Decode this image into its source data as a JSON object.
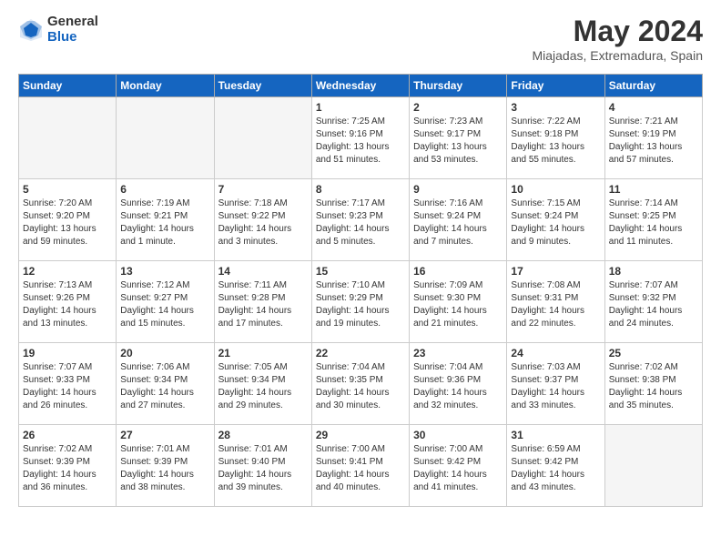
{
  "header": {
    "logo_general": "General",
    "logo_blue": "Blue",
    "title": "May 2024",
    "location": "Miajadas, Extremadura, Spain"
  },
  "columns": [
    "Sunday",
    "Monday",
    "Tuesday",
    "Wednesday",
    "Thursday",
    "Friday",
    "Saturday"
  ],
  "weeks": [
    [
      {
        "day": "",
        "info": ""
      },
      {
        "day": "",
        "info": ""
      },
      {
        "day": "",
        "info": ""
      },
      {
        "day": "1",
        "info": "Sunrise: 7:25 AM\nSunset: 9:16 PM\nDaylight: 13 hours\nand 51 minutes."
      },
      {
        "day": "2",
        "info": "Sunrise: 7:23 AM\nSunset: 9:17 PM\nDaylight: 13 hours\nand 53 minutes."
      },
      {
        "day": "3",
        "info": "Sunrise: 7:22 AM\nSunset: 9:18 PM\nDaylight: 13 hours\nand 55 minutes."
      },
      {
        "day": "4",
        "info": "Sunrise: 7:21 AM\nSunset: 9:19 PM\nDaylight: 13 hours\nand 57 minutes."
      }
    ],
    [
      {
        "day": "5",
        "info": "Sunrise: 7:20 AM\nSunset: 9:20 PM\nDaylight: 13 hours\nand 59 minutes."
      },
      {
        "day": "6",
        "info": "Sunrise: 7:19 AM\nSunset: 9:21 PM\nDaylight: 14 hours\nand 1 minute."
      },
      {
        "day": "7",
        "info": "Sunrise: 7:18 AM\nSunset: 9:22 PM\nDaylight: 14 hours\nand 3 minutes."
      },
      {
        "day": "8",
        "info": "Sunrise: 7:17 AM\nSunset: 9:23 PM\nDaylight: 14 hours\nand 5 minutes."
      },
      {
        "day": "9",
        "info": "Sunrise: 7:16 AM\nSunset: 9:24 PM\nDaylight: 14 hours\nand 7 minutes."
      },
      {
        "day": "10",
        "info": "Sunrise: 7:15 AM\nSunset: 9:24 PM\nDaylight: 14 hours\nand 9 minutes."
      },
      {
        "day": "11",
        "info": "Sunrise: 7:14 AM\nSunset: 9:25 PM\nDaylight: 14 hours\nand 11 minutes."
      }
    ],
    [
      {
        "day": "12",
        "info": "Sunrise: 7:13 AM\nSunset: 9:26 PM\nDaylight: 14 hours\nand 13 minutes."
      },
      {
        "day": "13",
        "info": "Sunrise: 7:12 AM\nSunset: 9:27 PM\nDaylight: 14 hours\nand 15 minutes."
      },
      {
        "day": "14",
        "info": "Sunrise: 7:11 AM\nSunset: 9:28 PM\nDaylight: 14 hours\nand 17 minutes."
      },
      {
        "day": "15",
        "info": "Sunrise: 7:10 AM\nSunset: 9:29 PM\nDaylight: 14 hours\nand 19 minutes."
      },
      {
        "day": "16",
        "info": "Sunrise: 7:09 AM\nSunset: 9:30 PM\nDaylight: 14 hours\nand 21 minutes."
      },
      {
        "day": "17",
        "info": "Sunrise: 7:08 AM\nSunset: 9:31 PM\nDaylight: 14 hours\nand 22 minutes."
      },
      {
        "day": "18",
        "info": "Sunrise: 7:07 AM\nSunset: 9:32 PM\nDaylight: 14 hours\nand 24 minutes."
      }
    ],
    [
      {
        "day": "19",
        "info": "Sunrise: 7:07 AM\nSunset: 9:33 PM\nDaylight: 14 hours\nand 26 minutes."
      },
      {
        "day": "20",
        "info": "Sunrise: 7:06 AM\nSunset: 9:34 PM\nDaylight: 14 hours\nand 27 minutes."
      },
      {
        "day": "21",
        "info": "Sunrise: 7:05 AM\nSunset: 9:34 PM\nDaylight: 14 hours\nand 29 minutes."
      },
      {
        "day": "22",
        "info": "Sunrise: 7:04 AM\nSunset: 9:35 PM\nDaylight: 14 hours\nand 30 minutes."
      },
      {
        "day": "23",
        "info": "Sunrise: 7:04 AM\nSunset: 9:36 PM\nDaylight: 14 hours\nand 32 minutes."
      },
      {
        "day": "24",
        "info": "Sunrise: 7:03 AM\nSunset: 9:37 PM\nDaylight: 14 hours\nand 33 minutes."
      },
      {
        "day": "25",
        "info": "Sunrise: 7:02 AM\nSunset: 9:38 PM\nDaylight: 14 hours\nand 35 minutes."
      }
    ],
    [
      {
        "day": "26",
        "info": "Sunrise: 7:02 AM\nSunset: 9:39 PM\nDaylight: 14 hours\nand 36 minutes."
      },
      {
        "day": "27",
        "info": "Sunrise: 7:01 AM\nSunset: 9:39 PM\nDaylight: 14 hours\nand 38 minutes."
      },
      {
        "day": "28",
        "info": "Sunrise: 7:01 AM\nSunset: 9:40 PM\nDaylight: 14 hours\nand 39 minutes."
      },
      {
        "day": "29",
        "info": "Sunrise: 7:00 AM\nSunset: 9:41 PM\nDaylight: 14 hours\nand 40 minutes."
      },
      {
        "day": "30",
        "info": "Sunrise: 7:00 AM\nSunset: 9:42 PM\nDaylight: 14 hours\nand 41 minutes."
      },
      {
        "day": "31",
        "info": "Sunrise: 6:59 AM\nSunset: 9:42 PM\nDaylight: 14 hours\nand 43 minutes."
      },
      {
        "day": "",
        "info": ""
      }
    ]
  ]
}
